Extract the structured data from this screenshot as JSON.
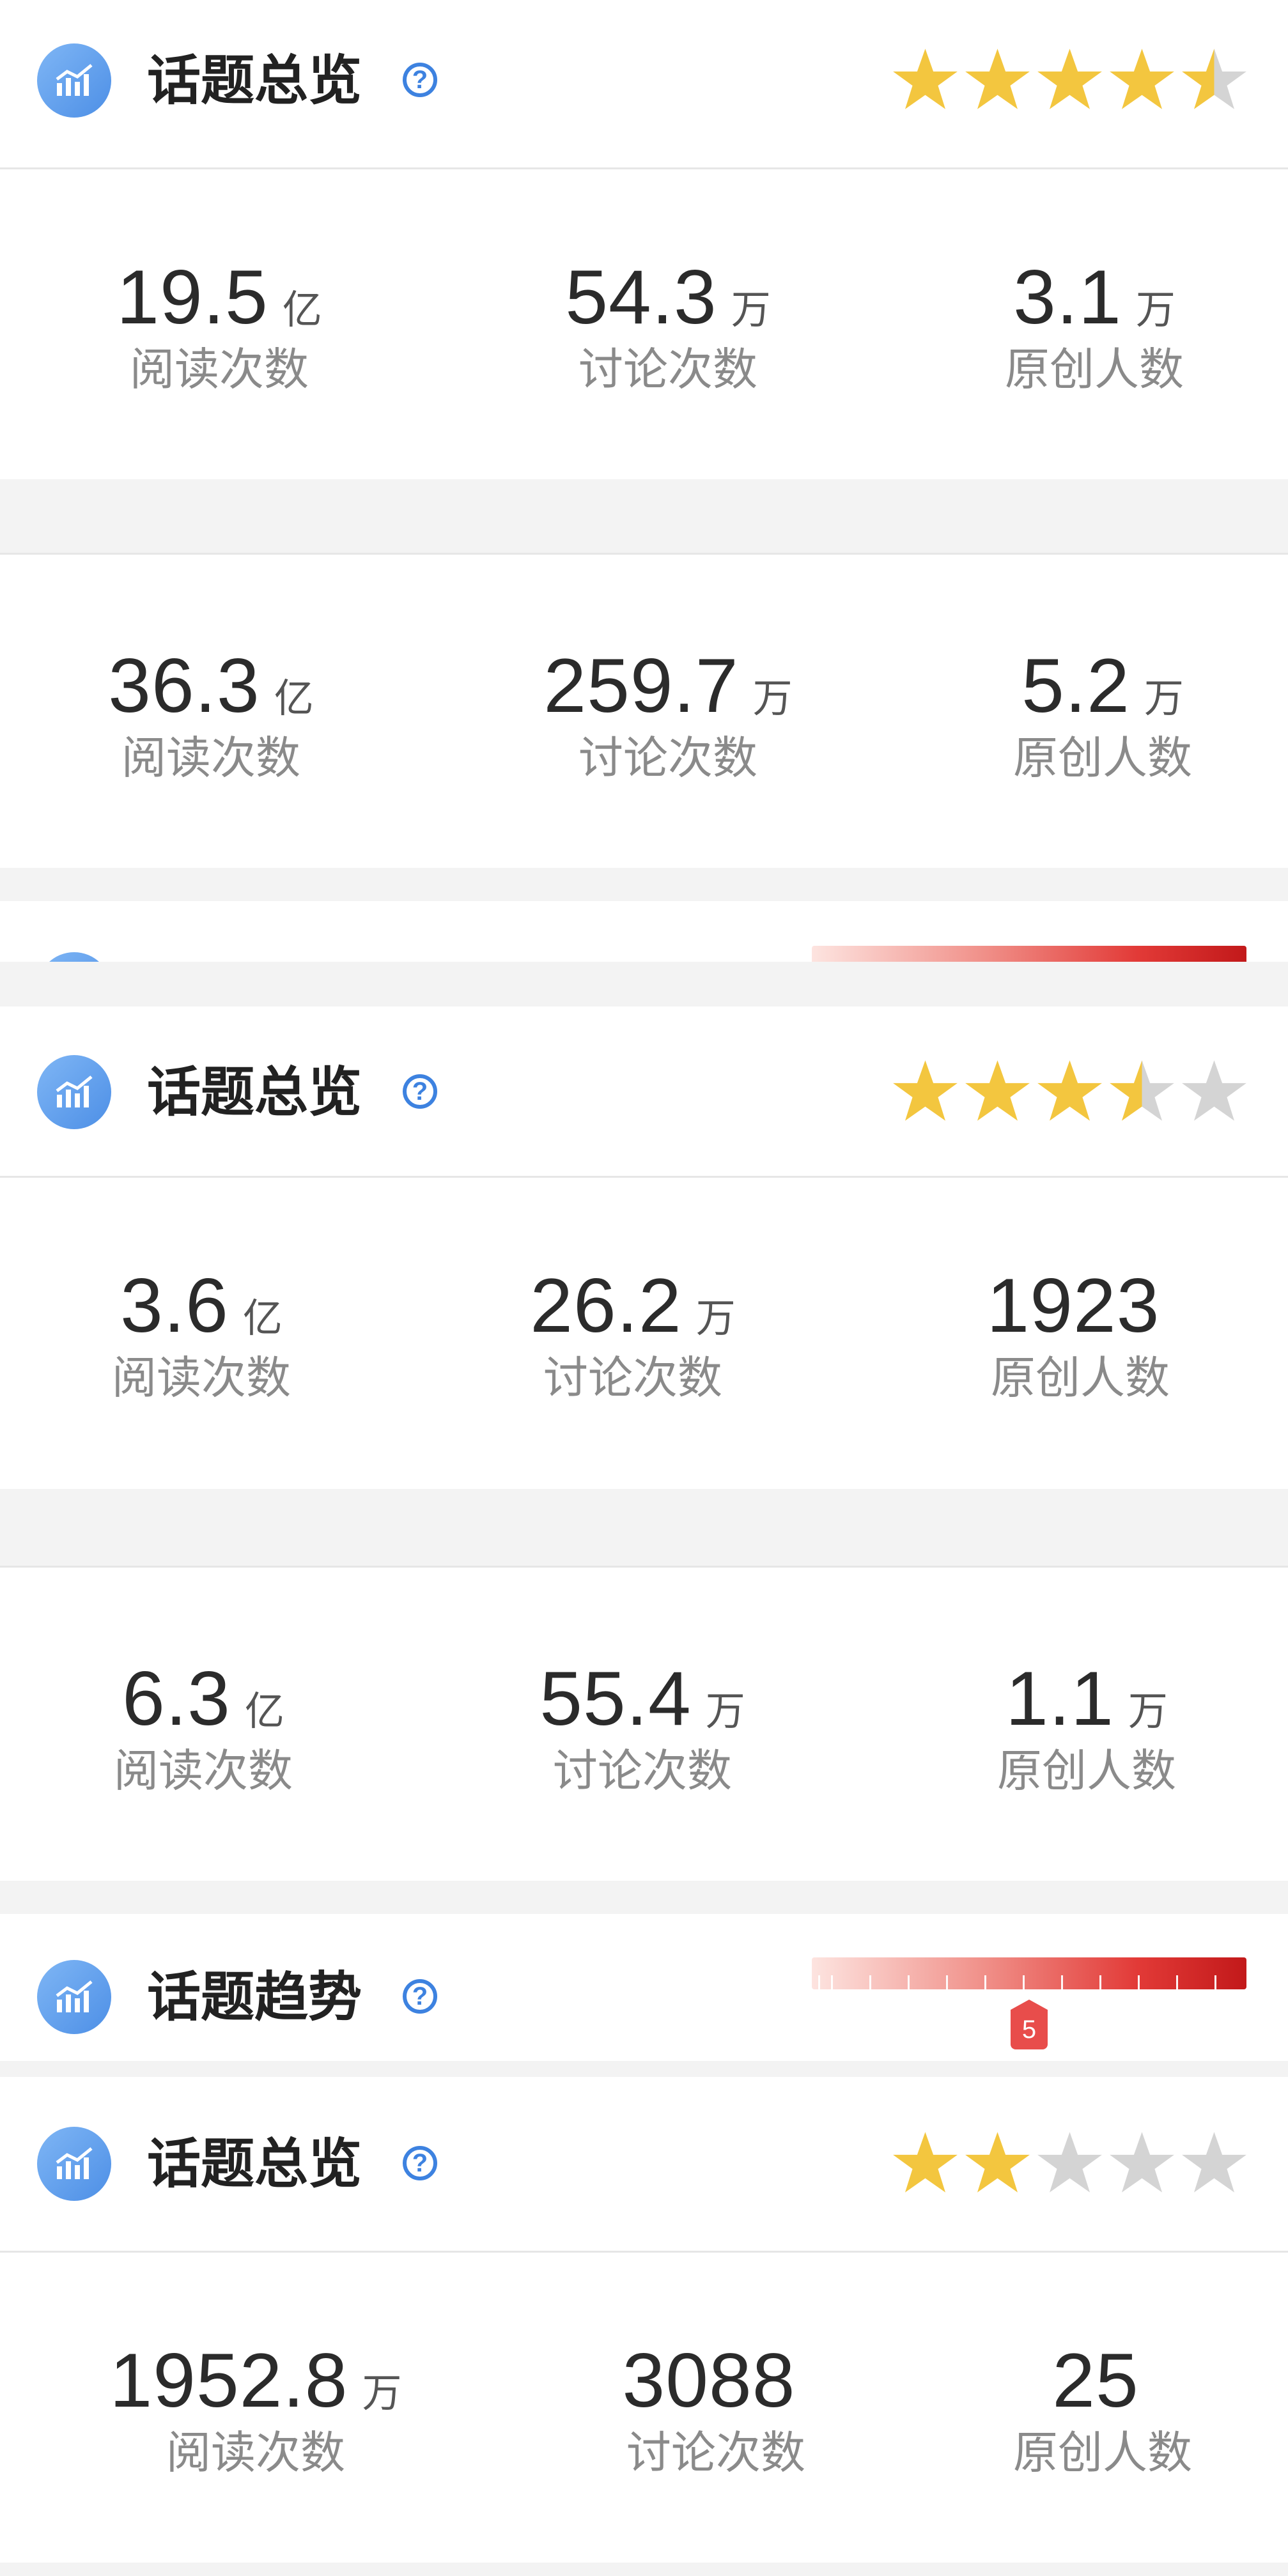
{
  "sections": {
    "overview_title": "话题总览",
    "trend_title": "话题趋势",
    "help_glyph": "?",
    "icon": "trend-chart-icon"
  },
  "cards": [
    {
      "rating": 4.5,
      "stats": [
        {
          "value": "19.5",
          "unit": "亿",
          "label": "阅读次数"
        },
        {
          "value": "54.3",
          "unit": "万",
          "label": "讨论次数"
        },
        {
          "value": "3.1",
          "unit": "万",
          "label": "原创人数"
        }
      ]
    },
    {
      "stats": [
        {
          "value": "36.3",
          "unit": "亿",
          "label": "阅读次数"
        },
        {
          "value": "259.7",
          "unit": "万",
          "label": "讨论次数"
        },
        {
          "value": "5.2",
          "unit": "万",
          "label": "原创人数"
        }
      ]
    },
    {
      "rating": 3.5,
      "stats": [
        {
          "value": "3.6",
          "unit": "亿",
          "label": "阅读次数"
        },
        {
          "value": "26.2",
          "unit": "万",
          "label": "讨论次数"
        },
        {
          "value": "1923",
          "unit": "",
          "label": "原创人数"
        }
      ]
    },
    {
      "stats": [
        {
          "value": "6.3",
          "unit": "亿",
          "label": "阅读次数"
        },
        {
          "value": "55.4",
          "unit": "万",
          "label": "讨论次数"
        },
        {
          "value": "1.1",
          "unit": "万",
          "label": "原创人数"
        }
      ]
    },
    {
      "rating": 2,
      "stats": [
        {
          "value": "1952.8",
          "unit": "万",
          "label": "阅读次数"
        },
        {
          "value": "3088",
          "unit": "",
          "label": "讨论次数"
        },
        {
          "value": "25",
          "unit": "",
          "label": "原创人数"
        }
      ]
    }
  ],
  "trend": {
    "heat_level": "5",
    "heat_level_fraction": 0.5
  },
  "colors": {
    "star_on": "#f3c63f",
    "star_off": "#d4d4d4",
    "accent": "#3d82e0",
    "heat_red": "#e23a37"
  }
}
